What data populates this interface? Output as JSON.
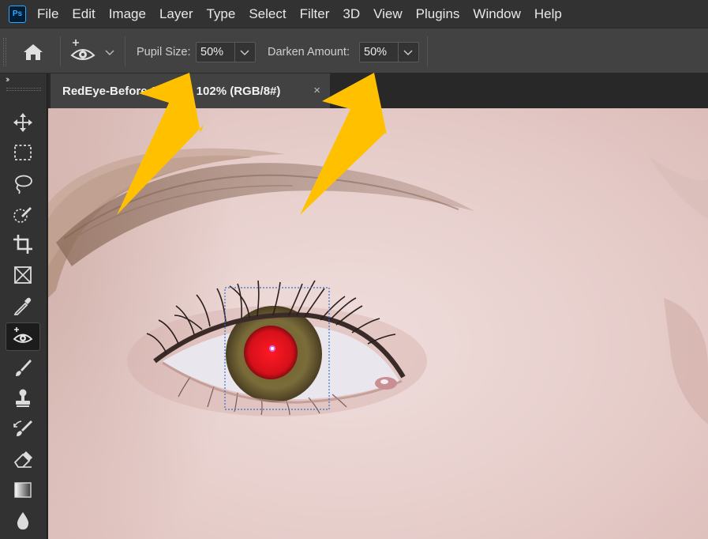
{
  "app": {
    "logo_text": "Ps"
  },
  "menu": [
    "File",
    "Edit",
    "Image",
    "Layer",
    "Type",
    "Select",
    "Filter",
    "3D",
    "View",
    "Plugins",
    "Window",
    "Help"
  ],
  "options": {
    "pupil_size_label": "Pupil Size:",
    "pupil_size_value": "50%",
    "darken_amount_label": "Darken Amount:",
    "darken_amount_value": "50%"
  },
  "document": {
    "tab_title": "RedEye-Before 1.jpg @ 102% (RGB/8#)",
    "close_glyph": "×"
  },
  "toolbar": {
    "collapse_glyph": "››",
    "tools": [
      "move-tool",
      "rectangular-marquee-tool",
      "lasso-tool",
      "quick-selection-tool",
      "crop-tool",
      "frame-tool",
      "eyedropper-tool",
      "red-eye-tool",
      "brush-tool",
      "clone-stamp-tool",
      "history-brush-tool",
      "eraser-tool",
      "gradient-tool",
      "blur-tool"
    ],
    "active_tool": "red-eye-tool"
  },
  "colors": {
    "accent_arrow": "#ffc000",
    "red_pupil": "#e0101a",
    "selection": "#3c6ec8"
  }
}
